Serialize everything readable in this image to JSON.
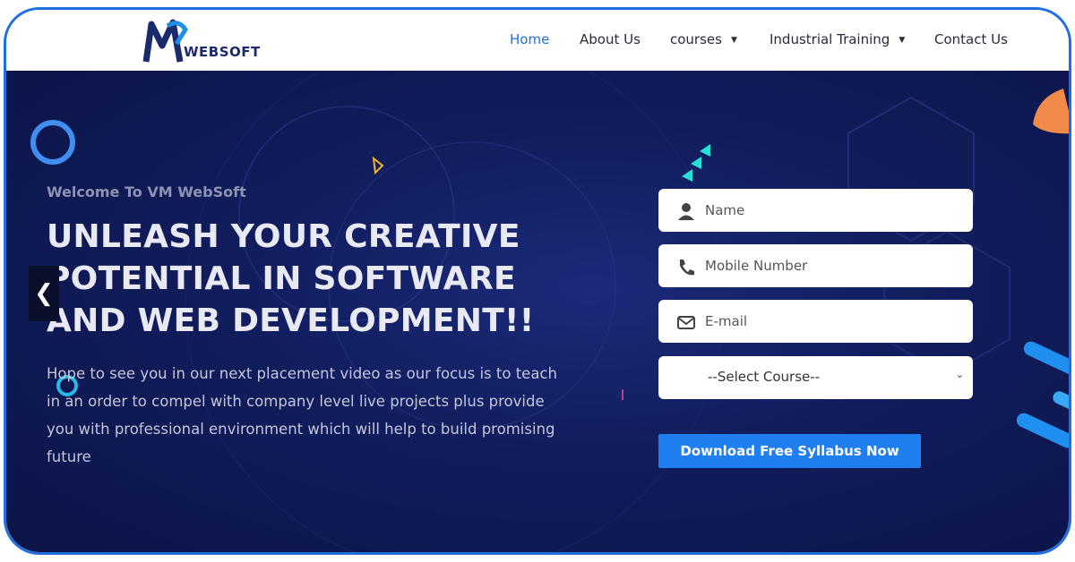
{
  "brand": {
    "logo_text": "WEBSOFT"
  },
  "nav": {
    "items": [
      {
        "label": "Home",
        "active": true,
        "dropdown": false
      },
      {
        "label": "About Us",
        "active": false,
        "dropdown": false
      },
      {
        "label": "courses",
        "active": false,
        "dropdown": true
      },
      {
        "label": "Industrial Training",
        "active": false,
        "dropdown": true
      },
      {
        "label": "Contact Us",
        "active": false,
        "dropdown": false
      }
    ],
    "caret_glyph": "▼"
  },
  "hero": {
    "welcome": "Welcome To VM WebSoft",
    "headline": "UNLEASH YOUR CREATIVE POTENTIAL IN SOFTWARE AND WEB DEVELOPMENT!!",
    "subtext": "Hope to see you in our next placement video as our focus is to teach in an order to compel with company level live projects plus provide you with professional environment which will help to build promising future",
    "prev_glyph": "❮"
  },
  "form": {
    "name_placeholder": "Name",
    "mobile_placeholder": "Mobile Number",
    "email_placeholder": "E-mail",
    "course_select": "--Select Course--",
    "submit_label": "Download Free Syllabus Now"
  },
  "colors": {
    "accent": "#1f6fe0",
    "hero_bg": "#111c5c",
    "cta": "#1f7ff0"
  }
}
